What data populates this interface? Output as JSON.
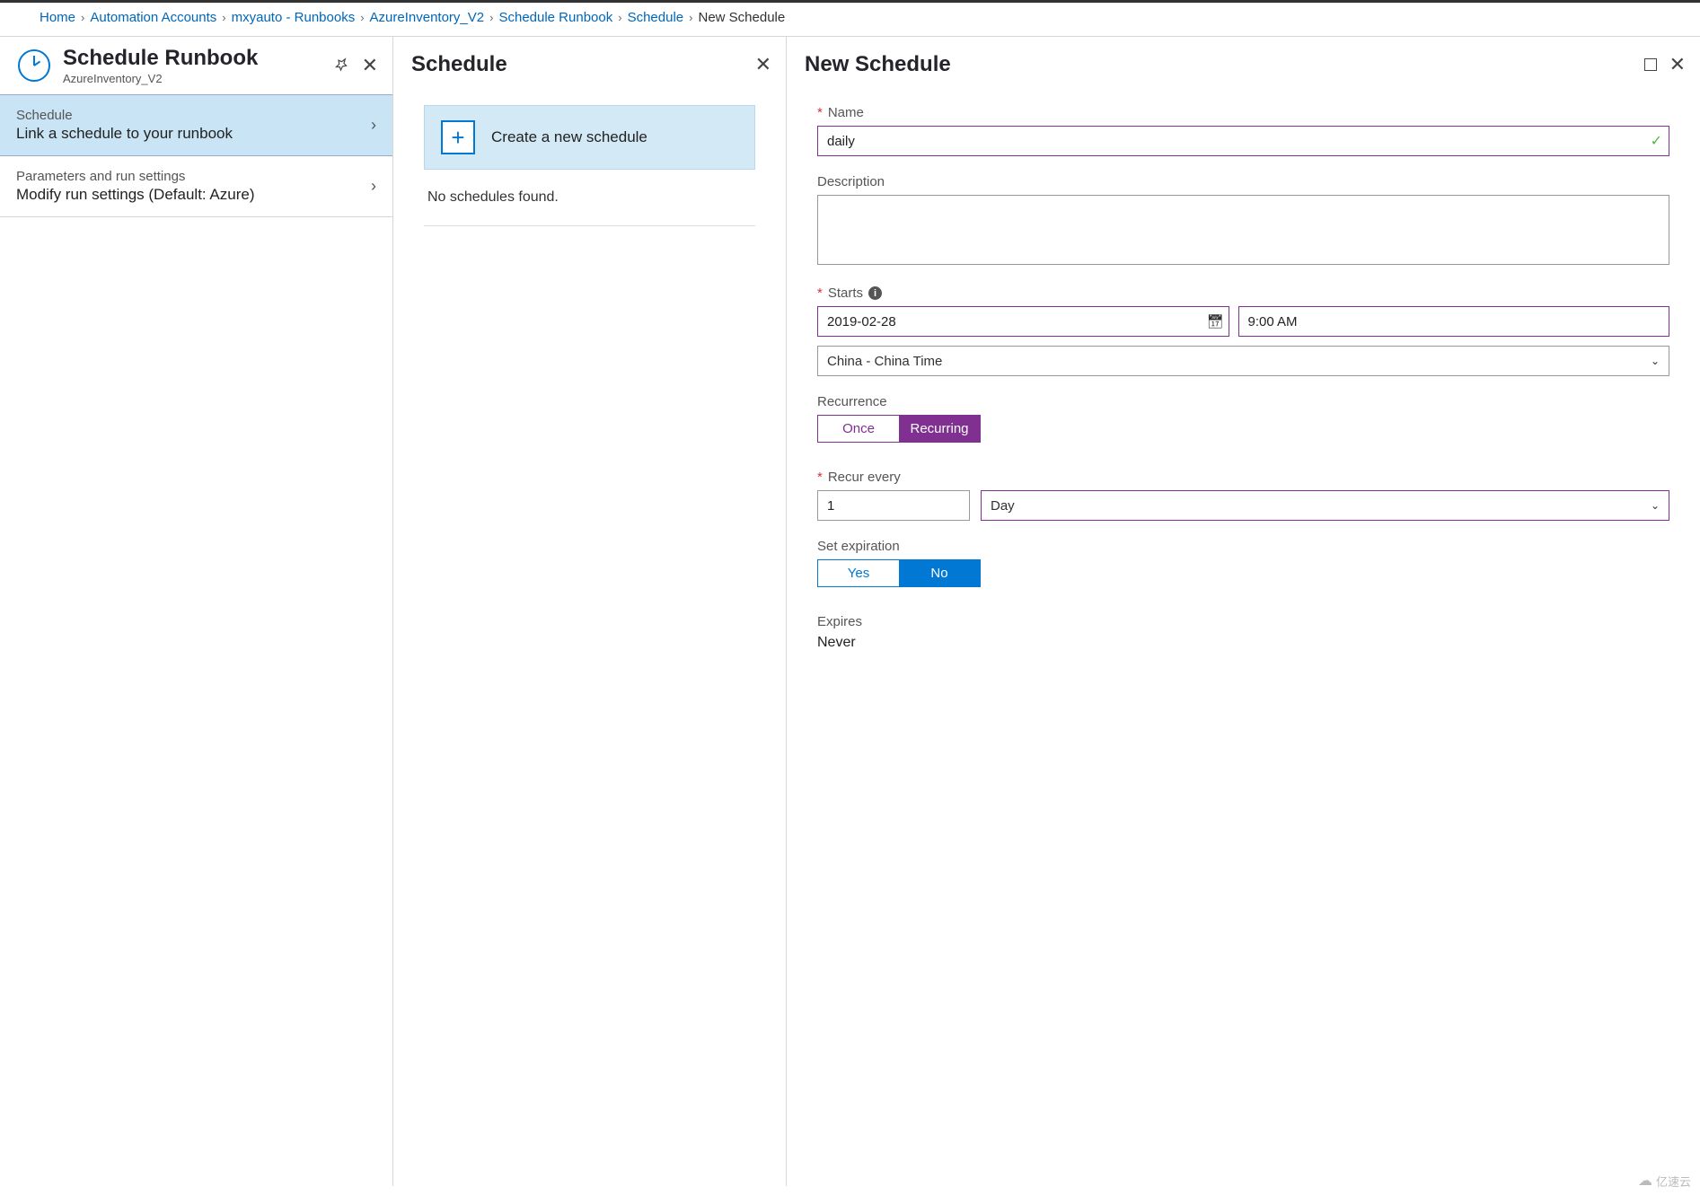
{
  "breadcrumb": {
    "items": [
      "Home",
      "Automation Accounts",
      "mxyauto - Runbooks",
      "AzureInventory_V2",
      "Schedule Runbook",
      "Schedule"
    ],
    "current": "New Schedule"
  },
  "panel1": {
    "title": "Schedule Runbook",
    "subtitle": "AzureInventory_V2",
    "rows": [
      {
        "title": "Schedule",
        "desc": "Link a schedule to your runbook",
        "selected": true
      },
      {
        "title": "Parameters and run settings",
        "desc": "Modify run settings (Default: Azure)",
        "selected": false
      }
    ]
  },
  "panel2": {
    "title": "Schedule",
    "create_label": "Create a new schedule",
    "empty_text": "No schedules found."
  },
  "panel3": {
    "title": "New Schedule",
    "name_label": "Name",
    "name_value": "daily",
    "description_label": "Description",
    "description_value": "",
    "starts_label": "Starts",
    "start_date": "2019-02-28",
    "start_time": "9:00 AM",
    "timezone": "China - China Time",
    "recurrence_label": "Recurrence",
    "recurrence_options": {
      "once": "Once",
      "recurring": "Recurring"
    },
    "recurrence_selected": "Recurring",
    "recur_every_label": "Recur every",
    "recur_value": "1",
    "recur_unit": "Day",
    "expiration_label": "Set expiration",
    "expiration_options": {
      "yes": "Yes",
      "no": "No"
    },
    "expiration_selected": "No",
    "expires_label": "Expires",
    "expires_value": "Never"
  },
  "watermark": "亿速云"
}
